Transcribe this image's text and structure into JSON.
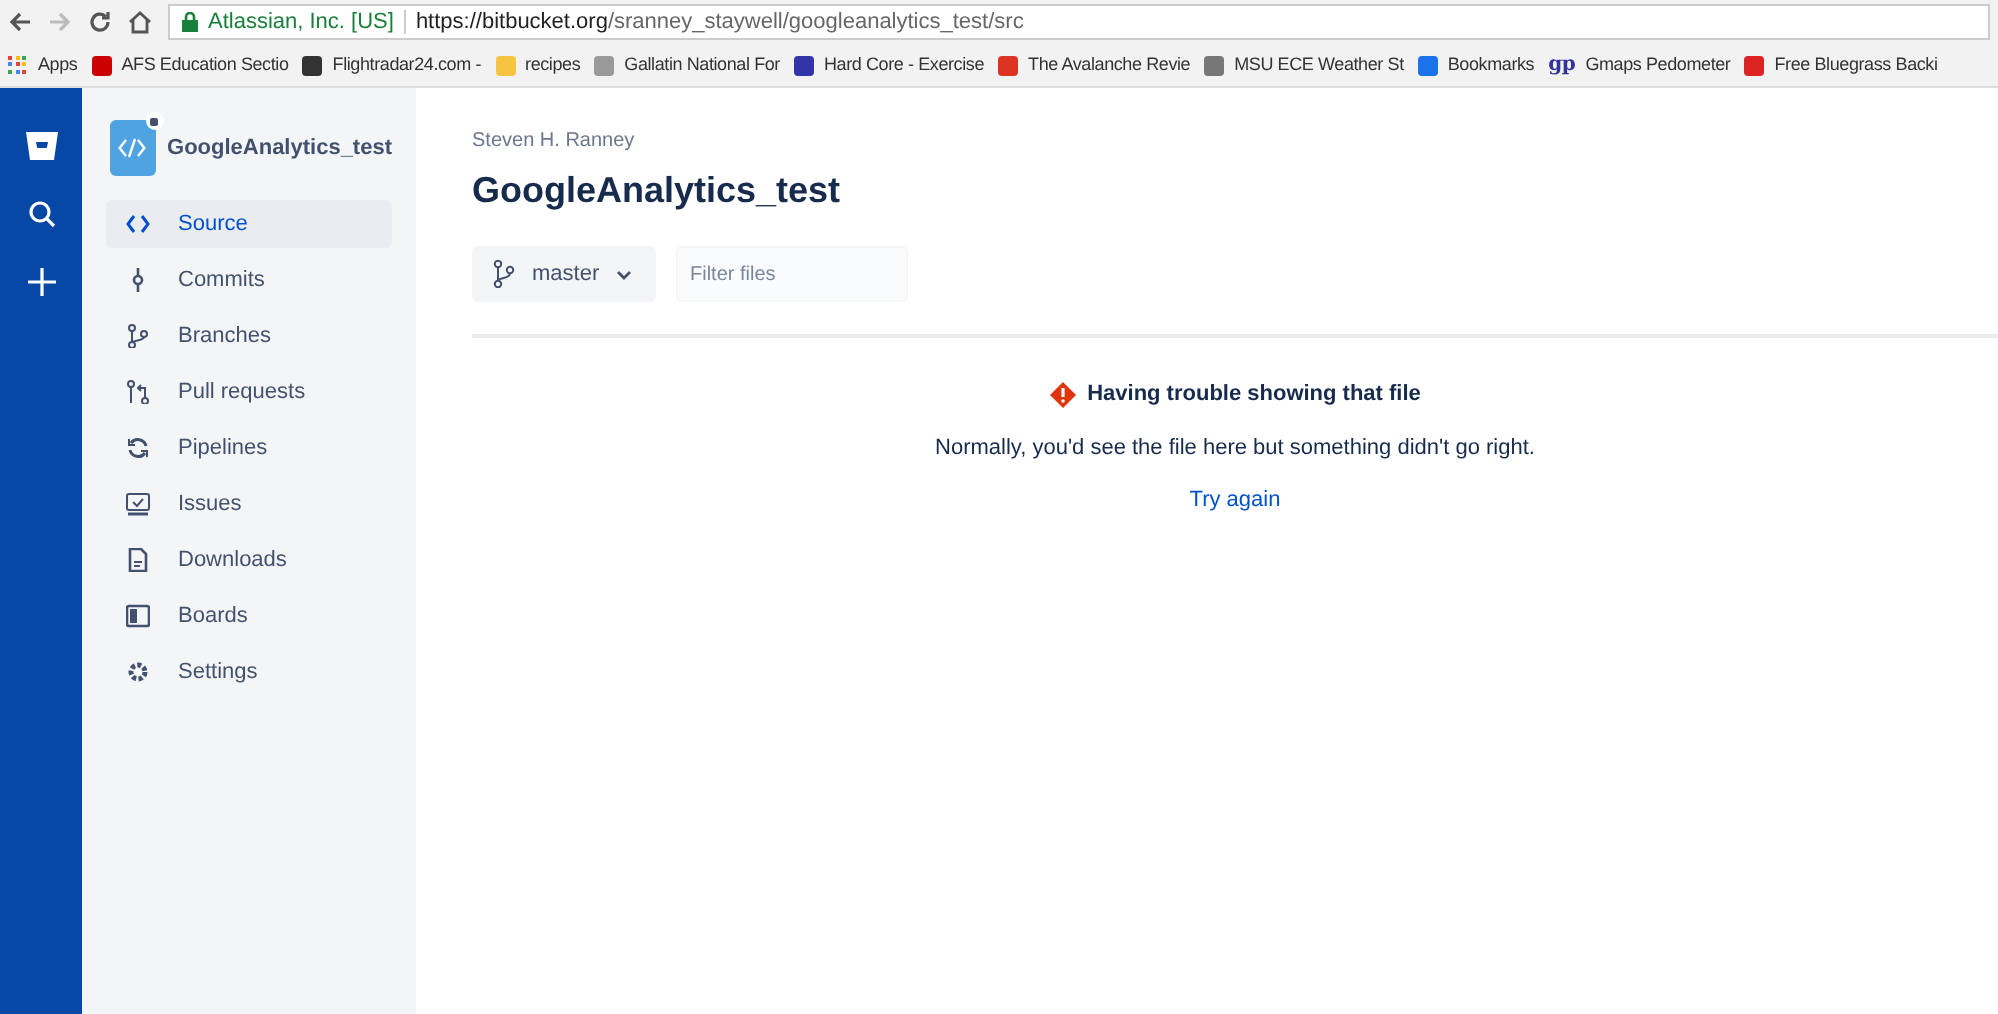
{
  "browser": {
    "site_identity": "Atlassian, Inc. [US]",
    "url_host": "https://bitbucket.org",
    "url_path": "/sranney_staywell/googleanalytics_test/src",
    "bookmarks": [
      {
        "label": "Apps"
      },
      {
        "label": "AFS Education Sectio"
      },
      {
        "label": "Flightradar24.com -"
      },
      {
        "label": "recipes"
      },
      {
        "label": "Gallatin National For"
      },
      {
        "label": "Hard Core - Exercise"
      },
      {
        "label": "The Avalanche Revie"
      },
      {
        "label": "MSU ECE Weather St"
      },
      {
        "label": "Bookmarks"
      },
      {
        "label": "Gmaps Pedometer",
        "favicon_text": "gp"
      },
      {
        "label": "Free Bluegrass Backi"
      }
    ]
  },
  "repo": {
    "name": "GoogleAnalytics_test",
    "private": true
  },
  "sidebar": {
    "items": [
      {
        "label": "Source",
        "selected": true
      },
      {
        "label": "Commits",
        "selected": false
      },
      {
        "label": "Branches",
        "selected": false
      },
      {
        "label": "Pull requests",
        "selected": false
      },
      {
        "label": "Pipelines",
        "selected": false
      },
      {
        "label": "Issues",
        "selected": false
      },
      {
        "label": "Downloads",
        "selected": false
      },
      {
        "label": "Boards",
        "selected": false
      },
      {
        "label": "Settings",
        "selected": false
      }
    ]
  },
  "header": {
    "owner": "Steven H. Ranney",
    "title": "GoogleAnalytics_test"
  },
  "toolbar": {
    "branch": "master",
    "filter": {
      "placeholder": "Filter files"
    }
  },
  "error": {
    "title": "Having trouble showing that file",
    "message": "Normally, you'd see the file here but something didn't go right.",
    "retry": "Try again"
  }
}
